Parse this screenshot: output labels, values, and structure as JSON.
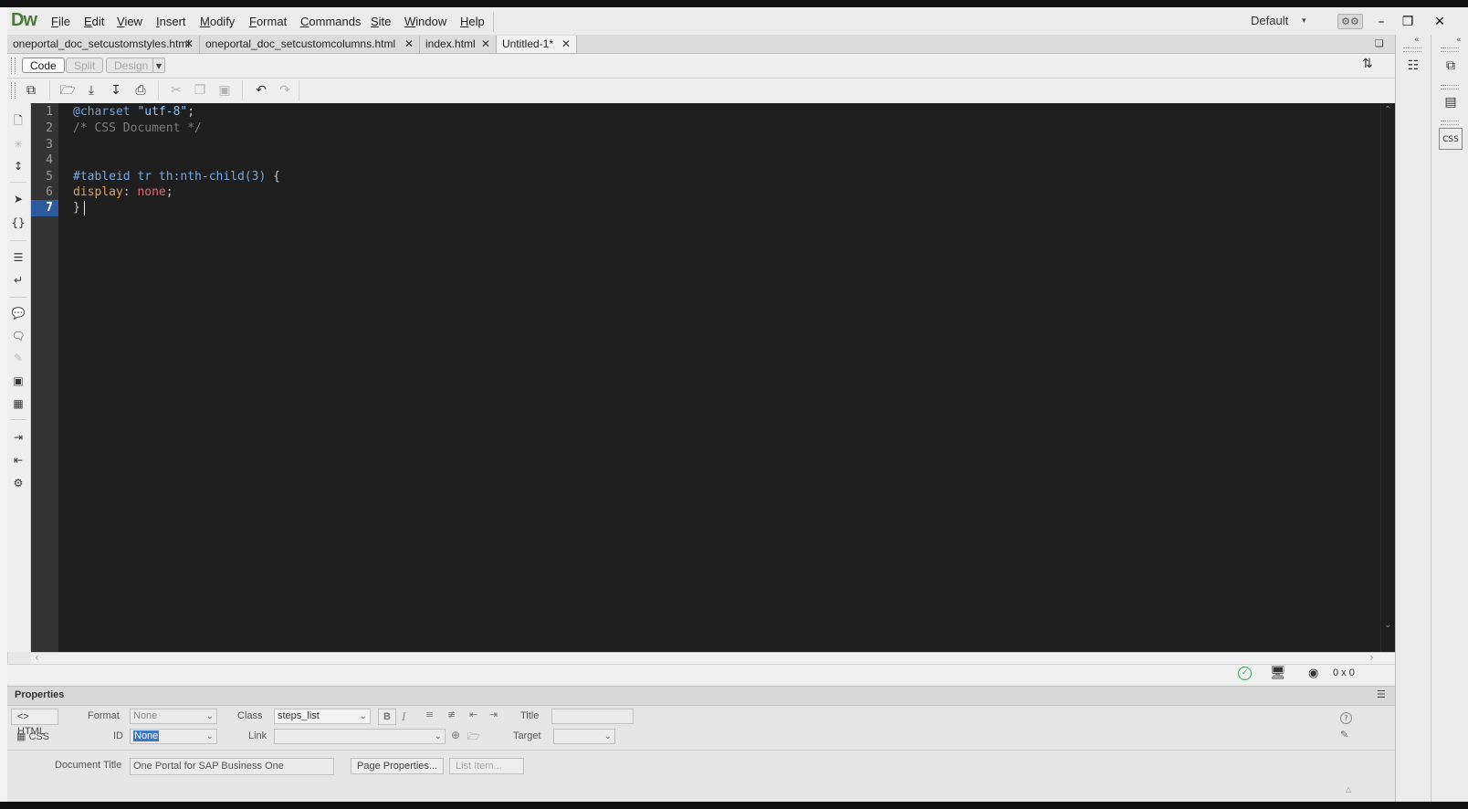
{
  "app": {
    "logo": "Dw",
    "menu": [
      {
        "label": "File",
        "u": "F",
        "rest": "ile"
      },
      {
        "label": "Edit",
        "u": "E",
        "rest": "dit"
      },
      {
        "label": "View",
        "u": "V",
        "rest": "iew"
      },
      {
        "label": "Insert",
        "u": "I",
        "rest": "nsert"
      },
      {
        "label": "Modify",
        "u": "M",
        "rest": "odify"
      },
      {
        "label": "Format",
        "u": "F",
        "rest": "ormat"
      },
      {
        "label": "Commands",
        "u": "C",
        "rest": "ommands"
      },
      {
        "label": "Site",
        "u": "S",
        "rest": "ite"
      },
      {
        "label": "Window",
        "u": "W",
        "rest": "indow"
      },
      {
        "label": "Help",
        "u": "H",
        "rest": "elp"
      }
    ],
    "workspace": "Default",
    "window_controls": {
      "minimize": "–",
      "restore": "❐",
      "close": "✕"
    }
  },
  "tabs": [
    {
      "label": "oneportal_doc_setcustomstyles.html",
      "close": "✕"
    },
    {
      "label": "oneportal_doc_setcustomcolumns.html",
      "close": "✕"
    },
    {
      "label": "index.html",
      "close": "✕"
    },
    {
      "label": "Untitled-1*",
      "close": "✕",
      "active": true
    }
  ],
  "viewbar": {
    "code": "Code",
    "split": "Split",
    "design": "Design"
  },
  "editor": {
    "line_numbers": [
      "1",
      "2",
      "3",
      "4",
      "5",
      "6",
      "7"
    ],
    "current_line": "7",
    "lines": {
      "l1_at": "@charset",
      "l1_str": "\"utf-8\"",
      "l1_punc": ";",
      "l2": "/* CSS Document */",
      "l5_sel": "#tableid tr th:nth-child(3)",
      "l5_brace": "{",
      "l6_prop": "display",
      "l6_colon": ":",
      "l6_val": "none",
      "l6_semi": ";",
      "l7": "}"
    }
  },
  "status": {
    "ok_icon": "check-circle-icon",
    "size": "0 x 0"
  },
  "properties": {
    "title": "Properties",
    "html_label": "HTML",
    "css_label": "CSS",
    "format_label": "Format",
    "format_value": "None",
    "class_label": "Class",
    "class_value": "steps_list",
    "bold": "B",
    "italic": "I",
    "title_label": "Title",
    "id_label": "ID",
    "id_value": "None",
    "link_label": "Link",
    "target_label": "Target",
    "doc_title_label": "Document Title",
    "doc_title_value": "One Portal for SAP Business One",
    "page_props_btn": "Page Properties...",
    "list_item_btn": "List Item..."
  },
  "colors": {
    "editor_bg": "#1e1e1e",
    "gutter_bg": "#333333",
    "current_line": "#2d5a9e",
    "logo": "#4a7a3a"
  }
}
